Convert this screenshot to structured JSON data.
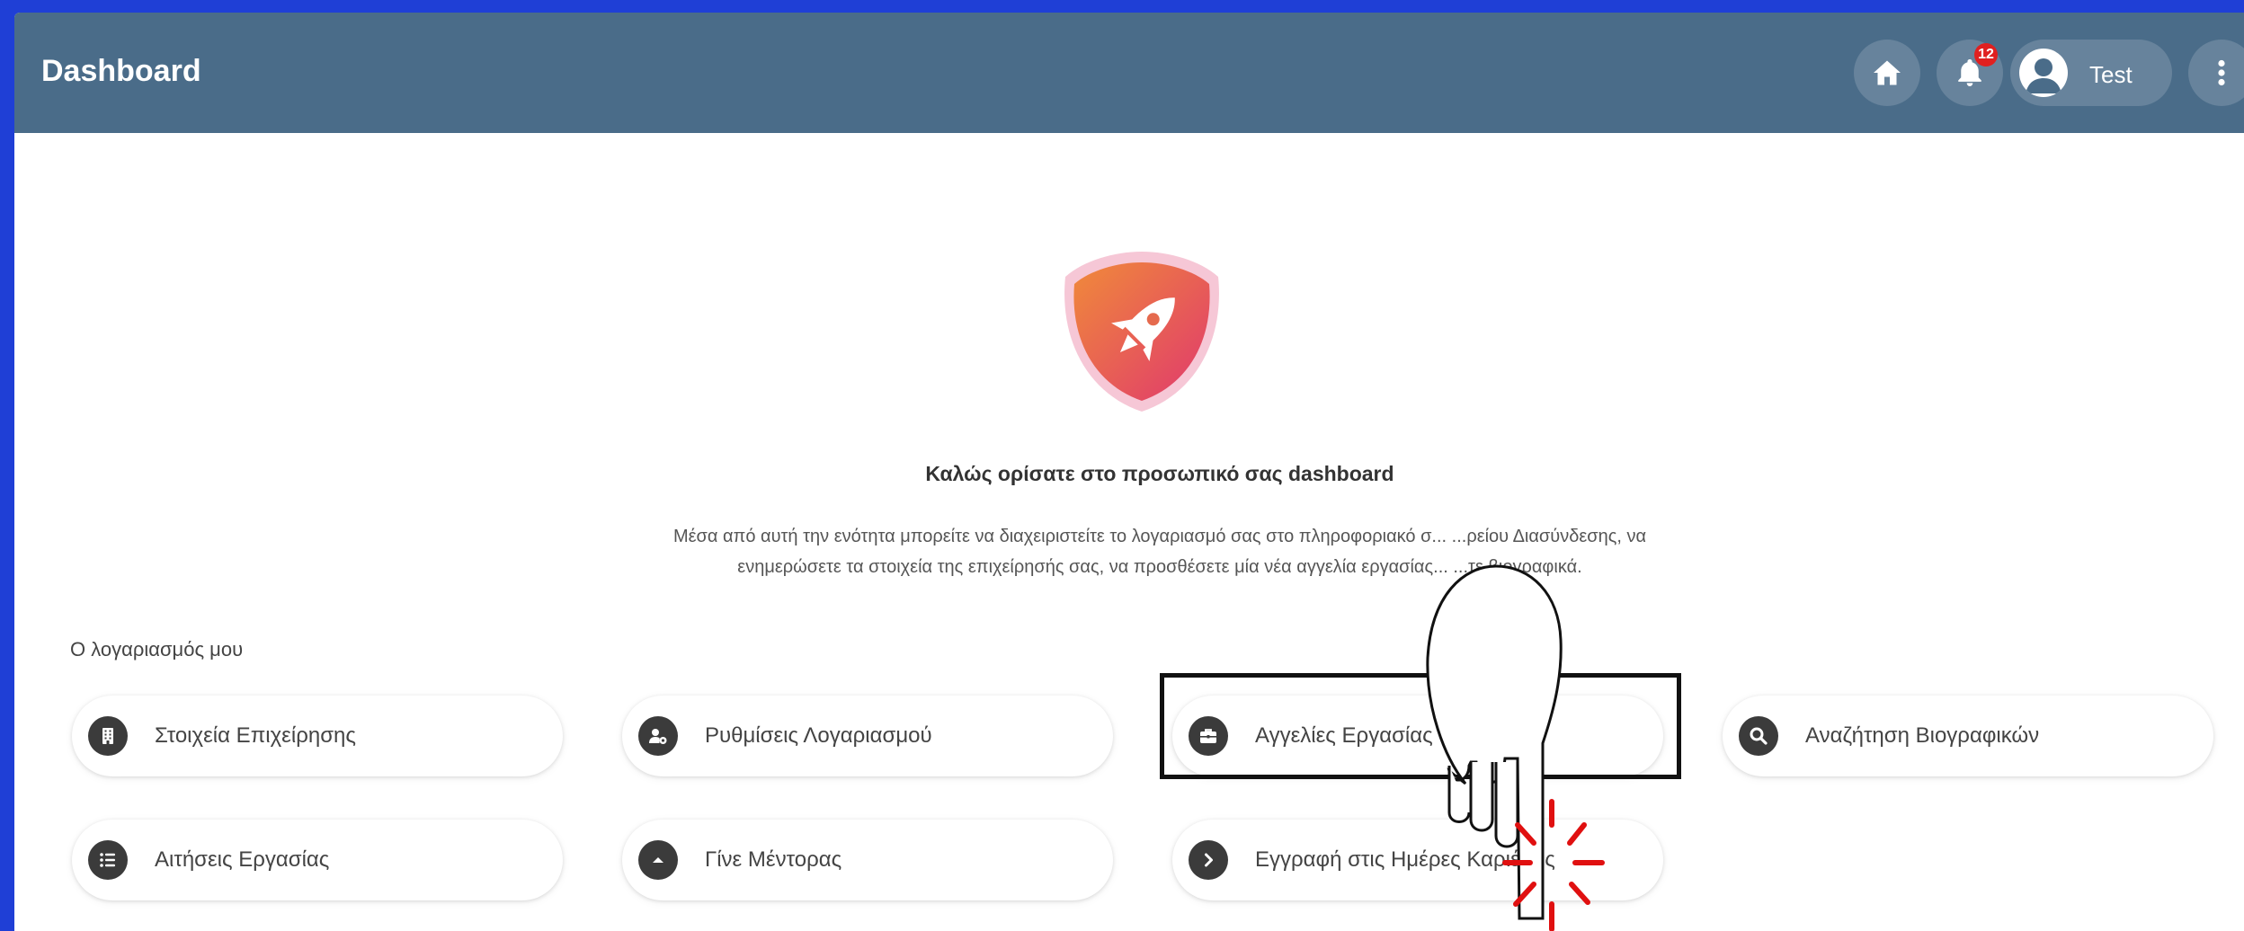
{
  "header": {
    "title": "Dashboard",
    "notifications_count": "12",
    "user_name": "Test"
  },
  "main": {
    "welcome_title": "Καλώς ορίσατε στο προσωπικό σας dashboard",
    "description_line1": "Μέσα από αυτή την ενότητα μπορείτε να διαχειριστείτε το λογαριασμό σας στο πληροφοριακό σ... ...ρείου Διασύνδεσης, να",
    "description_line2": "ενημερώσετε τα στοιχεία της επιχείρησής σας, να προσθέσετε μία νέα αγγελία εργασίας... ...τε βιογραφικά.",
    "section_label": "Ο λογαριασμός μου",
    "tiles": [
      {
        "label": "Στοιχεία Επιχείρησης",
        "icon": "building-icon"
      },
      {
        "label": "Ρυθμίσεις Λογαριασμού",
        "icon": "user-gear-icon"
      },
      {
        "label": "Αγγελίες Εργασίας",
        "icon": "briefcase-icon"
      },
      {
        "label": "Αναζήτηση Βιογραφικών",
        "icon": "search-icon"
      },
      {
        "label": "Αιτήσεις Εργασίας",
        "icon": "list-icon"
      },
      {
        "label": "Γίνε Μέντορας",
        "icon": "chevron-up-icon"
      },
      {
        "label": "Εγγραφή στις Ημέρες Καριέρας",
        "icon": "chevron-right-icon"
      }
    ]
  },
  "colors": {
    "outer_background": "#1f3fd6",
    "header_bar": "#4a6c89",
    "tile_icon_bg": "#3b3b3b",
    "hero_gradient_start": "#f08a3a",
    "hero_gradient_end": "#e0386e",
    "notification_badge": "#e02020",
    "pointer_burst": "#e01010"
  }
}
